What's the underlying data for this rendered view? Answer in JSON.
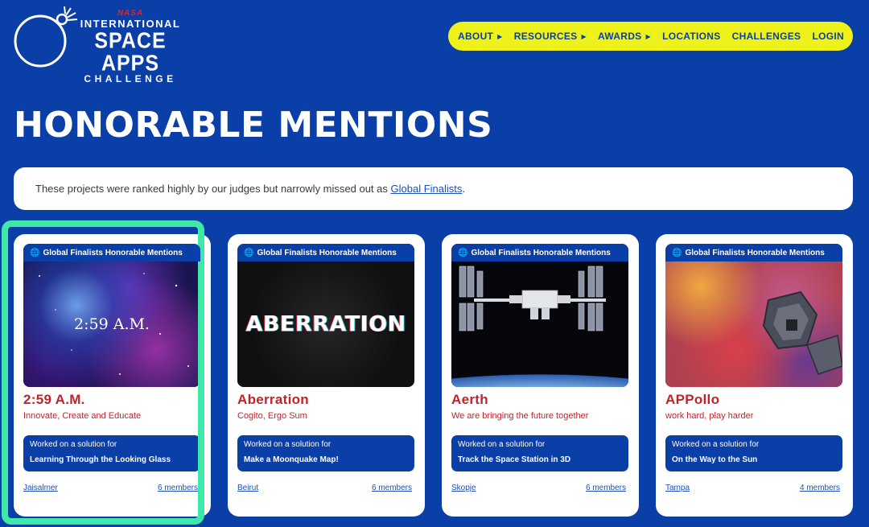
{
  "logo": {
    "nasa": "NASA",
    "line1": "INTERNATIONAL",
    "line2": "SPACE APPS",
    "line3": "CHALLENGE"
  },
  "nav": {
    "about": "ABOUT",
    "resources": "RESOURCES",
    "awards": "AWARDS",
    "locations": "LOCATIONS",
    "challenges": "CHALLENGES",
    "login": "LOGIN"
  },
  "page": {
    "title": "HONORABLE MENTIONS",
    "intro_text": "These projects were ranked highly by our judges but narrowly missed out as ",
    "intro_link": "Global Finalists",
    "intro_end": "."
  },
  "cards": [
    {
      "badge": "Global Finalists Honorable Mentions",
      "image_text": "2:59 A.M.",
      "title": "2:59 A.M.",
      "tagline": "Innovate, Create and Educate",
      "worked_label": "Worked on a solution for",
      "challenge": "Learning Through the Looking Glass",
      "location": "Jaisalmer",
      "members": "6 members"
    },
    {
      "badge": "Global Finalists Honorable Mentions",
      "image_text": "ABERRATION",
      "title": "Aberration",
      "tagline": "Cogito, Ergo Sum",
      "worked_label": "Worked on a solution for",
      "challenge": "Make a Moonquake Map!",
      "location": "Beirut",
      "members": "6 members"
    },
    {
      "badge": "Global Finalists Honorable Mentions",
      "title": "Aerth",
      "tagline": "We are bringing the future together",
      "worked_label": "Worked on a solution for",
      "challenge": "Track the Space Station in 3D",
      "location": "Skopje",
      "members": "6 members"
    },
    {
      "badge": "Global Finalists Honorable Mentions",
      "title": "APPollo",
      "tagline": "work hard, play harder",
      "worked_label": "Worked on a solution for",
      "challenge": "On the Way to the Sun",
      "location": "Tampa",
      "members": "4 members"
    }
  ],
  "colors": {
    "background": "#0b3fa8",
    "nav_bg": "#eef21a",
    "title_red": "#c0242b",
    "highlight": "#3ee8a8"
  }
}
